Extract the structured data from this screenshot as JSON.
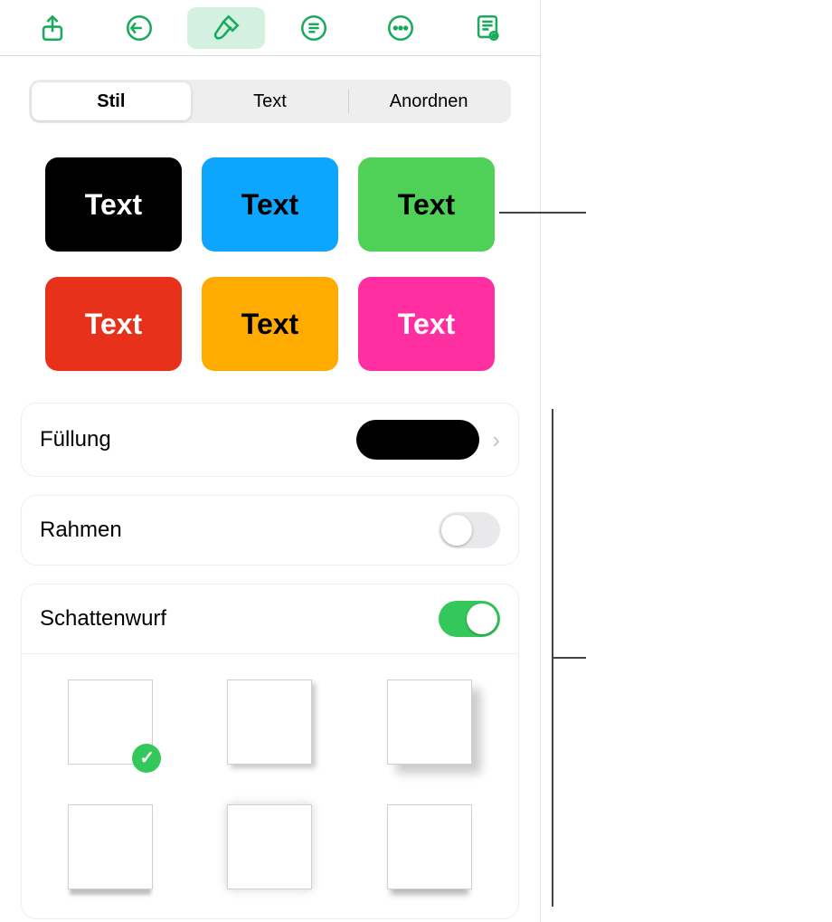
{
  "toolbar": {
    "icons": [
      "share-icon",
      "undo-icon",
      "format-brush-icon",
      "list-icon",
      "more-icon",
      "read-mode-icon"
    ],
    "activeIndex": 2
  },
  "tabs": {
    "items": [
      "Stil",
      "Text",
      "Anordnen"
    ],
    "activeIndex": 0
  },
  "styleSwatches": [
    {
      "label": "Text",
      "bg": "#000000",
      "fg": "#ffffff"
    },
    {
      "label": "Text",
      "bg": "#0da6ff",
      "fg": "#000000"
    },
    {
      "label": "Text",
      "bg": "#4fd157",
      "fg": "#000000"
    },
    {
      "label": "Text",
      "bg": "#e8311a",
      "fg": "#ffffff"
    },
    {
      "label": "Text",
      "bg": "#ffab00",
      "fg": "#000000"
    },
    {
      "label": "Text",
      "bg": "#ff2fa2",
      "fg": "#ffffff"
    }
  ],
  "fill": {
    "label": "Füllung",
    "color": "#000000"
  },
  "border": {
    "label": "Rahmen",
    "on": false
  },
  "shadow": {
    "label": "Schattenwurf",
    "on": true,
    "selectedIndex": 0,
    "options": [
      "none",
      "drop-soft",
      "drop-far",
      "bottom-line",
      "glow",
      "bottom-shadow"
    ]
  }
}
